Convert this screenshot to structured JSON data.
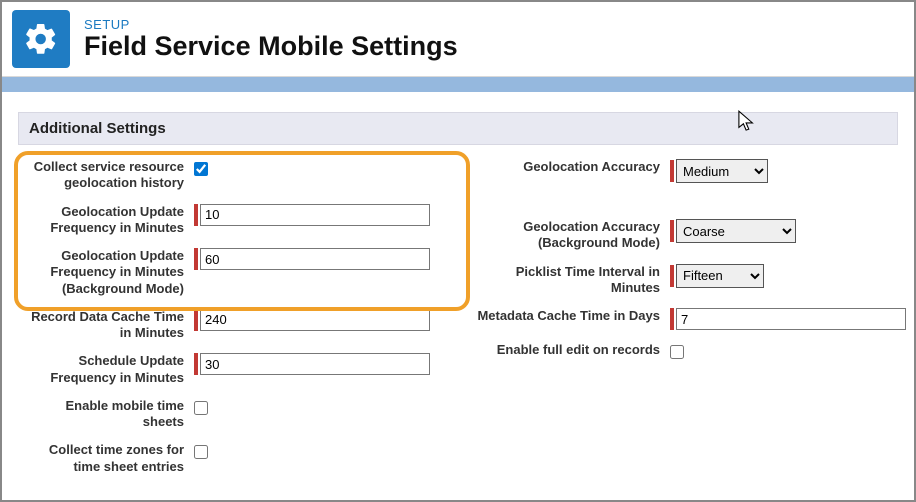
{
  "header": {
    "eyebrow": "SETUP",
    "title": "Field Service Mobile Settings"
  },
  "section_title": "Additional Settings",
  "left": {
    "collect_history_label": "Collect service resource geolocation history",
    "collect_history_checked": true,
    "geo_update_label": "Geolocation Update Frequency in Minutes",
    "geo_update_value": "10",
    "geo_update_bg_label": "Geolocation Update Frequency in Minutes (Background Mode)",
    "geo_update_bg_value": "60",
    "record_cache_label": "Record Data Cache Time in Minutes",
    "record_cache_value": "240",
    "schedule_update_label": "Schedule Update Frequency in Minutes",
    "schedule_update_value": "30",
    "mobile_ts_label": "Enable mobile time sheets",
    "mobile_ts_checked": false,
    "tz_label": "Collect time zones for time sheet entries",
    "tz_checked": false
  },
  "right": {
    "geo_acc_label": "Geolocation Accuracy",
    "geo_acc_value": "Medium",
    "geo_acc_bg_label": "Geolocation Accuracy (Background Mode)",
    "geo_acc_bg_value": "Coarse",
    "picklist_label": "Picklist Time Interval in Minutes",
    "picklist_value": "Fifteen",
    "meta_cache_label": "Metadata Cache Time in Days",
    "meta_cache_value": "7",
    "full_edit_label": "Enable full edit on records",
    "full_edit_checked": false
  }
}
